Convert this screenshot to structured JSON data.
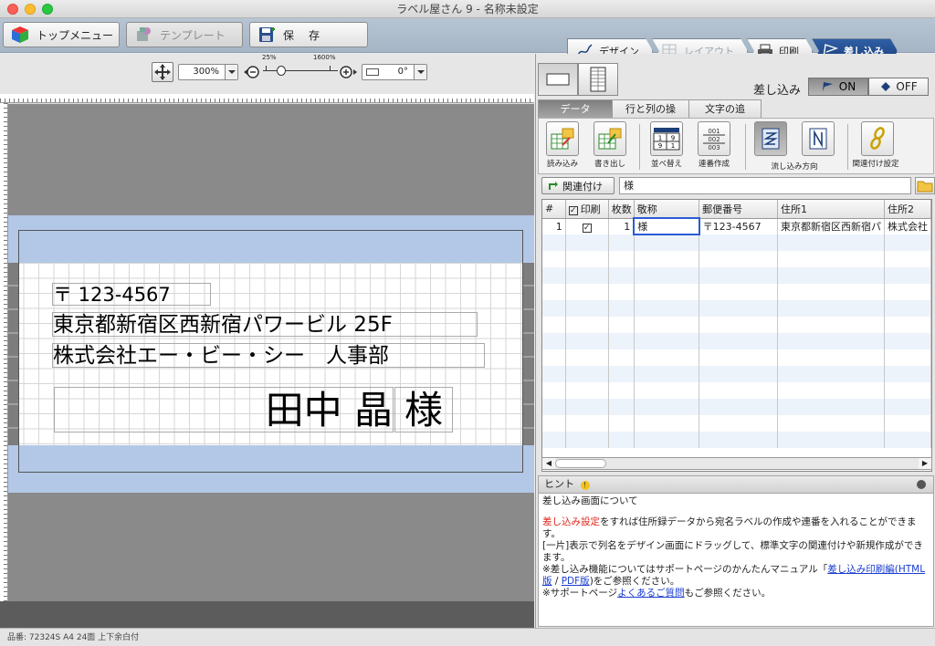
{
  "window": {
    "title": "ラベル屋さん 9 - 名称未設定"
  },
  "toolbar": {
    "top_menu": "トップメニュー",
    "template": "テンプレート",
    "save": "保　存"
  },
  "steps": [
    "デザイン",
    "レイアウト",
    "印刷",
    "差し込み"
  ],
  "zoom": {
    "value": "300%",
    "slider_min": "25%",
    "slider_max": "1600%",
    "rotation": "0°"
  },
  "label": {
    "postal": "〒 123-4567",
    "address": "東京都新宿区西新宿パワービル 25F",
    "company": "株式会社エー・ビー・シー　人事部",
    "name": "田中 晶",
    "honorific": "様"
  },
  "status": "品番: 72324S A4 24面 上下余白付",
  "merge": {
    "label": "差し込み",
    "on": "ON",
    "off": "OFF"
  },
  "tabs": [
    "データ",
    "行と列の操作",
    "文字の追加"
  ],
  "tools": [
    "読み込み",
    "書き出し",
    "並べ替え",
    "連番作成",
    "流し込み方向",
    "関連付け設定"
  ],
  "sort_icon": {
    "a": "1",
    "b": "9",
    "c": "9",
    "d": "1"
  },
  "serial_icon": {
    "a": "001",
    "b": "002",
    "c": "003"
  },
  "link": {
    "button": "関連付け",
    "value": "様"
  },
  "grid": {
    "headers": [
      "#",
      "印刷",
      "枚数",
      "敬称",
      "郵便番号",
      "住所1",
      "住所2"
    ],
    "rows": [
      {
        "no": "1",
        "qty": "1",
        "honorific": "様",
        "zip": "〒123-4567",
        "addr1": "東京都新宿区西新宿パ",
        "addr2": "株式会社"
      }
    ]
  },
  "hint": {
    "title": "ヒント",
    "heading": "差し込み画面について",
    "p1_red": "差し込み設定",
    "p1_rest": "をすれば住所録データから宛名ラベルの作成や連番を入れることができます。",
    "p2": "[一片]表示で列名をデザイン画面にドラッグして、標準文字の関連付けや新規作成ができます。",
    "p3_a": "※差し込み機能についてはサポートページのかんたんマニュアル「",
    "p3_link1": "差し込み印刷編(HTML版",
    "p3_sep": " / ",
    "p3_link2": "PDF版",
    "p3_b": ")をご参照ください。",
    "p4_a": "※サポートページ",
    "p4_link": "よくあるご質問",
    "p4_b": "もご参照ください。"
  },
  "colors": {
    "accent": "#1c3f7a",
    "label_band": "#b3c8e6",
    "hint_red": "#e2261c"
  }
}
